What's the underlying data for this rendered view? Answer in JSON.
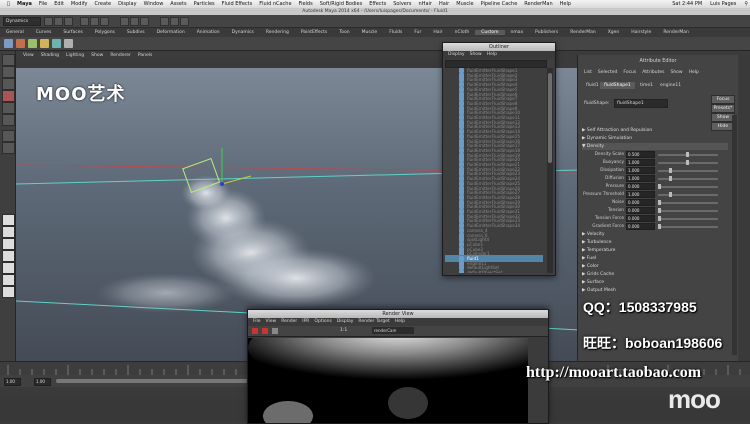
{
  "mac_menubar": {
    "apple": "",
    "items": [
      "Maya",
      "File",
      "Edit",
      "Modify",
      "Create",
      "Display",
      "Window",
      "Assets",
      "Particles",
      "Fluid Effects",
      "Fluid nCache",
      "Fields",
      "Soft/Rigid Bodies",
      "Effects",
      "Solvers",
      "nHair",
      "Hair",
      "Muscle",
      "Pipeline Cache",
      "RenderMan",
      "Help"
    ],
    "clock": "Sat 2:44 PM",
    "user": "Luis Pages"
  },
  "window_title": "Autodesk Maya 2014 x64 - /Users/luispages/Documents/ - Fluid1",
  "mode_menu": "Dynamics",
  "shelf": {
    "tabs": [
      "General",
      "Curves",
      "Surfaces",
      "Polygons",
      "Subdivs",
      "Deformation",
      "Animation",
      "Dynamics",
      "Rendering",
      "PaintEffects",
      "Toon",
      "Muscle",
      "Fluids",
      "Fur",
      "Hair",
      "nCloth",
      "Custom",
      "nmax",
      "Publishers",
      "RenderMan",
      "Xgen",
      "Hairstyle",
      "RenderMan"
    ],
    "active_tab": "Custom"
  },
  "viewport": {
    "menu": [
      "View",
      "Shading",
      "Lighting",
      "Show",
      "Renderer",
      "Panels"
    ],
    "watermark": "MOO艺术"
  },
  "outliner": {
    "title": "Outliner",
    "menu": [
      "Display",
      "Show",
      "Help"
    ],
    "rows": [
      {
        "label": "fluidEmitterFluidShape1"
      },
      {
        "label": "fluidEmitterFluidShape2"
      },
      {
        "label": "fluidEmitterFluidShape3"
      },
      {
        "label": "fluidEmitterFluidShape4"
      },
      {
        "label": "fluidEmitterFluidShape5"
      },
      {
        "label": "fluidEmitterFluidShape6"
      },
      {
        "label": "fluidEmitterFluidShape7"
      },
      {
        "label": "fluidEmitterFluidShape8"
      },
      {
        "label": "fluidEmitterFluidShape9"
      },
      {
        "label": "fluidEmitterFluidShape10"
      },
      {
        "label": "fluidEmitterFluidShape11"
      },
      {
        "label": "fluidEmitterFluidShape12"
      },
      {
        "label": "fluidEmitterFluidShape13"
      },
      {
        "label": "fluidEmitterFluidShape14"
      },
      {
        "label": "fluidEmitterFluidShape15"
      },
      {
        "label": "fluidEmitterFluidShape16"
      },
      {
        "label": "fluidEmitterFluidShape17"
      },
      {
        "label": "fluidEmitterFluidShape18"
      },
      {
        "label": "fluidEmitterFluidShape19"
      },
      {
        "label": "fluidEmitterFluidShape20"
      },
      {
        "label": "fluidEmitterFluidShape21"
      },
      {
        "label": "fluidEmitterFluidShape22"
      },
      {
        "label": "fluidEmitterFluidShape23"
      },
      {
        "label": "fluidEmitterFluidShape24"
      },
      {
        "label": "fluidEmitterFluidShape25"
      },
      {
        "label": "fluidEmitterFluidShape26"
      },
      {
        "label": "fluidEmitterFluidShape27"
      },
      {
        "label": "fluidEmitterFluidShape28"
      },
      {
        "label": "fluidEmitterFluidShape29"
      },
      {
        "label": "fluidEmitterFluidShape30"
      },
      {
        "label": "fluidEmitterFluidShape31"
      },
      {
        "label": "fluidEmitterFluidShape32"
      },
      {
        "label": "fluidEmitterFluidShape33"
      },
      {
        "label": "fluidEmitterFluidShape34"
      },
      {
        "label": "camera_4"
      },
      {
        "label": "camera_6"
      },
      {
        "label": "spotLight4"
      },
      {
        "label": "pCube1"
      },
      {
        "label": "pCube2"
      },
      {
        "label": "pCylinder1"
      },
      {
        "label": "fluid1"
      },
      {
        "label": "engine11"
      },
      {
        "label": "defaultLightSet"
      },
      {
        "label": "defaultObjectSet"
      }
    ],
    "selected": "fluid1"
  },
  "attribute_editor": {
    "title": "Attribute Editor",
    "menu": [
      "List",
      "Selected",
      "Focus",
      "Attributes",
      "Show",
      "Help"
    ],
    "tabs": [
      "fluid1",
      "fluidShape1",
      "time1",
      "engine11"
    ],
    "active_tab": "fluidShape1",
    "node_label": "fluidShape:",
    "node_value": "fluidShape1",
    "buttons": [
      "Focus",
      "Presets*",
      "Show",
      "Hide"
    ],
    "sections_top": [
      "Self Attraction and Repulsion",
      "Dynamic Simulation"
    ],
    "open_section": "Density",
    "density_props": [
      {
        "label": "Density Scale",
        "value": "0.500",
        "fill": 0.5
      },
      {
        "label": "Buoyancy",
        "value": "1.000",
        "fill": 0.5
      },
      {
        "label": "Dissipation",
        "value": "1.000",
        "fill": 0.2
      },
      {
        "label": "Diffusion",
        "value": "1.000",
        "fill": 0.2
      },
      {
        "label": "Pressure",
        "value": "0.000",
        "fill": 0.0
      },
      {
        "label": "Pressure Threshold",
        "value": "1.000",
        "fill": 0.2
      },
      {
        "label": "Noise",
        "value": "0.000",
        "fill": 0.0
      },
      {
        "label": "Tension",
        "value": "0.000",
        "fill": 0.0
      },
      {
        "label": "Tension Force",
        "value": "0.000",
        "fill": 0.0
      },
      {
        "label": "Gradient Force",
        "value": "0.000",
        "fill": 0.0
      }
    ],
    "sections_bottom": [
      "Velocity",
      "Turbulence",
      "Temperature",
      "Fuel",
      "Color",
      "Grids Cache",
      "Surface",
      "Output Mesh"
    ]
  },
  "time_slider": {
    "start": "1.00",
    "end": "1.00"
  },
  "render_view": {
    "title": "Render View",
    "menu": [
      "File",
      "View",
      "Render",
      "IPR",
      "Options",
      "Display",
      "Render Target",
      "Help"
    ],
    "ratio": "1:1",
    "camera": "renderCam"
  },
  "overlay": {
    "qq": "QQ：1508337985",
    "wangwang": "旺旺：boboan198606",
    "url": "http://mooart.taobao.com",
    "logo": "moo"
  }
}
